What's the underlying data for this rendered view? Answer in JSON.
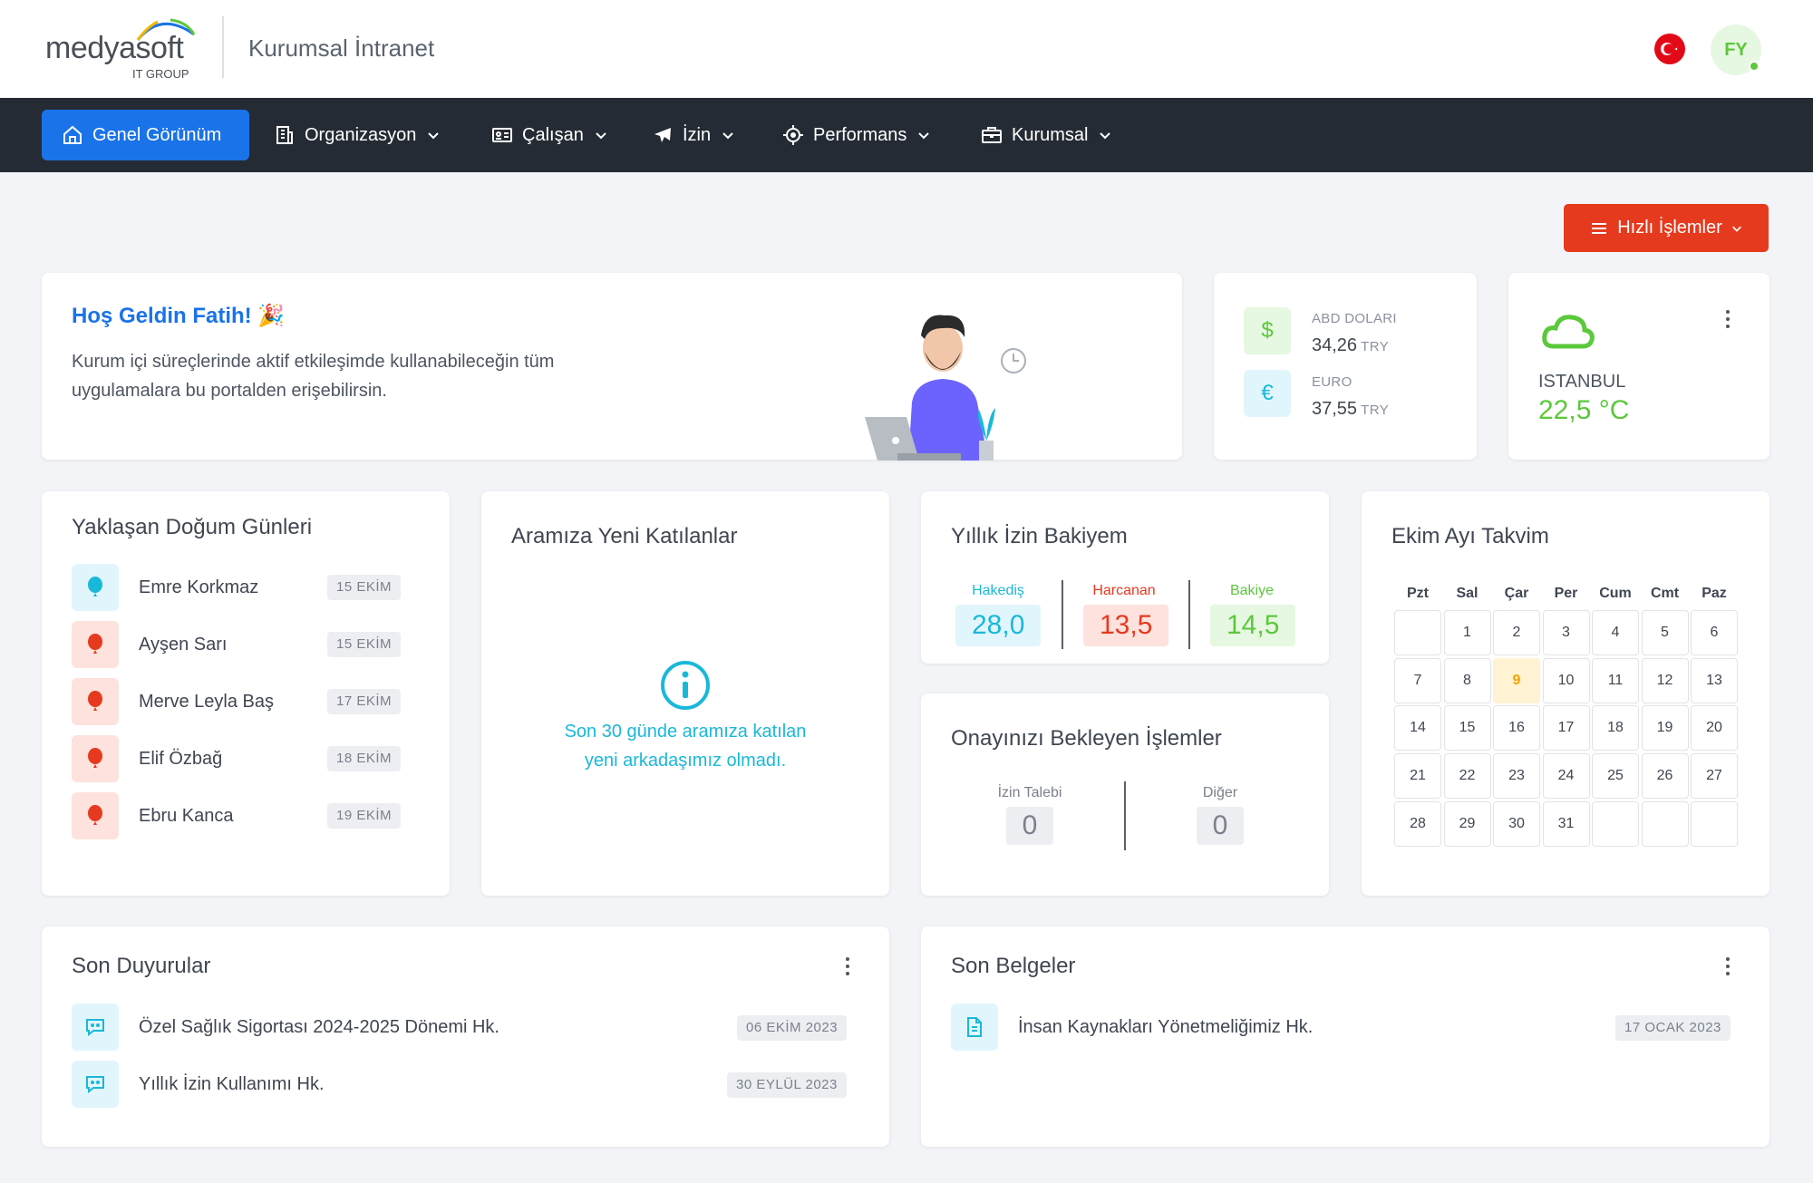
{
  "header": {
    "logo_text": "medyasoft",
    "logo_sub": "IT GROUP",
    "app_title": "Kurumsal İntranet",
    "avatar_initials": "FY"
  },
  "nav": {
    "items": [
      {
        "label": "Genel Görünüm",
        "icon": "home-icon",
        "active": true
      },
      {
        "label": "Organizasyon",
        "icon": "building-icon"
      },
      {
        "label": "Çalışan",
        "icon": "id-card-icon"
      },
      {
        "label": "İzin",
        "icon": "plane-icon"
      },
      {
        "label": "Performans",
        "icon": "target-icon"
      },
      {
        "label": "Kurumsal",
        "icon": "briefcase-icon"
      }
    ]
  },
  "quick_actions": {
    "label": "Hızlı İşlemler"
  },
  "welcome": {
    "title": "Hoş Geldin Fatih! 🎉",
    "text": "Kurum içi süreçlerinde aktif etkileşimde kullanabileceğin tüm uygulamalara bu portalden erişebilirsin."
  },
  "currency": {
    "usd": {
      "symbol": "$",
      "label": "ABD DOLARI",
      "value": "34,26",
      "unit": "TRY"
    },
    "eur": {
      "symbol": "€",
      "label": "EURO",
      "value": "37,55",
      "unit": "TRY"
    }
  },
  "weather": {
    "city": "ISTANBUL",
    "temp": "22,5 °C"
  },
  "birthdays": {
    "title": "Yaklaşan Doğum Günleri",
    "items": [
      {
        "name": "Emre Korkmaz",
        "date": "15 EKİM"
      },
      {
        "name": "Ayşen Sarı",
        "date": "15 EKİM"
      },
      {
        "name": "Merve Leyla Baş",
        "date": "17 EKİM"
      },
      {
        "name": "Elif Özbağ",
        "date": "18 EKİM"
      },
      {
        "name": "Ebru Kanca",
        "date": "19 EKİM"
      }
    ]
  },
  "newcomers": {
    "title": "Aramıza Yeni Katılanlar",
    "empty_line1": "Son 30 günde aramıza katılan",
    "empty_line2": "yeni arkadaşımız olmadı."
  },
  "leave": {
    "title": "Yıllık İzin Bakiyem",
    "earned_label": "Hakediş",
    "earned": "28,0",
    "used_label": "Harcanan",
    "used": "13,5",
    "balance_label": "Bakiye",
    "balance": "14,5"
  },
  "pending": {
    "title": "Onayınızı Bekleyen İşlemler",
    "leave_label": "İzin Talebi",
    "leave_count": "0",
    "other_label": "Diğer",
    "other_count": "0"
  },
  "calendar": {
    "title": "Ekim Ayı Takvim",
    "days": [
      "Pzt",
      "Sal",
      "Çar",
      "Per",
      "Cum",
      "Cmt",
      "Paz"
    ],
    "cells": [
      "",
      "1",
      "2",
      "3",
      "4",
      "5",
      "6",
      "7",
      "8",
      "9",
      "10",
      "11",
      "12",
      "13",
      "14",
      "15",
      "16",
      "17",
      "18",
      "19",
      "20",
      "21",
      "22",
      "23",
      "24",
      "25",
      "26",
      "27",
      "28",
      "29",
      "30",
      "31",
      "",
      "",
      ""
    ],
    "today": "9"
  },
  "announcements": {
    "title": "Son Duyurular",
    "items": [
      {
        "text": "Özel Sağlık Sigortası 2024-2025 Dönemi Hk.",
        "date": "06 EKİM 2023"
      },
      {
        "text": "Yıllık İzin Kullanımı Hk.",
        "date": "30 EYLÜL 2023"
      }
    ]
  },
  "documents": {
    "title": "Son Belgeler",
    "items": [
      {
        "text": "İnsan Kaynakları Yönetmeliğimiz Hk.",
        "date": "17 OCAK 2023"
      }
    ]
  },
  "colors": {
    "primary": "#1a73e8",
    "danger": "#e63a1f",
    "success": "#5cc83c",
    "info": "#1ab8d8",
    "nav_bg": "#252b34"
  }
}
